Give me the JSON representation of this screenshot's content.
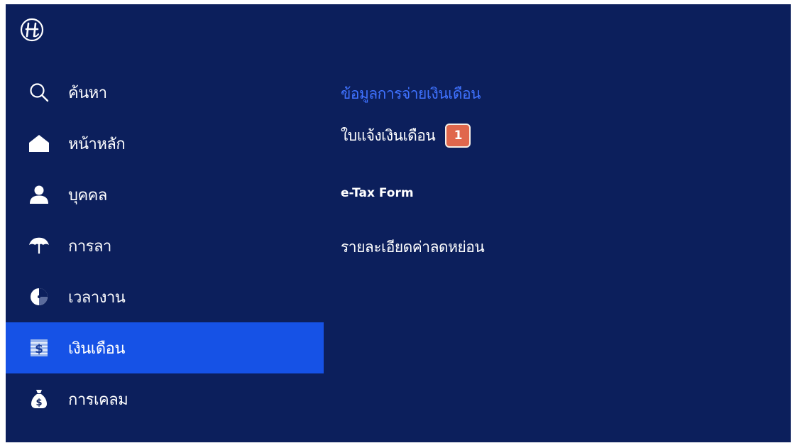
{
  "colors": {
    "background": "#0c1f5c",
    "active_item": "#1652e6",
    "section_title": "#3f72ff",
    "badge": "#e0674c"
  },
  "logo": {
    "icon": "company-logo-icon"
  },
  "sidebar": {
    "items": [
      {
        "label": "ค้นหา",
        "icon": "search-icon",
        "active": false
      },
      {
        "label": "หน้าหลัก",
        "icon": "home-icon",
        "active": false
      },
      {
        "label": "บุคคล",
        "icon": "person-icon",
        "active": false
      },
      {
        "label": "การลา",
        "icon": "umbrella-icon",
        "active": false
      },
      {
        "label": "เวลางาน",
        "icon": "clock-icon",
        "active": false
      },
      {
        "label": "เงินเดือน",
        "icon": "salary-icon",
        "active": true
      },
      {
        "label": "การเคลม",
        "icon": "money-bag-icon",
        "active": false
      }
    ]
  },
  "content": {
    "section_title": "ข้อมูลการจ่ายเงินเดือน",
    "items": [
      {
        "label": "ใบแจ้งเงินเดือน",
        "badge": "1"
      },
      {
        "label": "e-Tax Form"
      },
      {
        "label": "รายละเอียดค่าลดหย่อน"
      }
    ]
  }
}
